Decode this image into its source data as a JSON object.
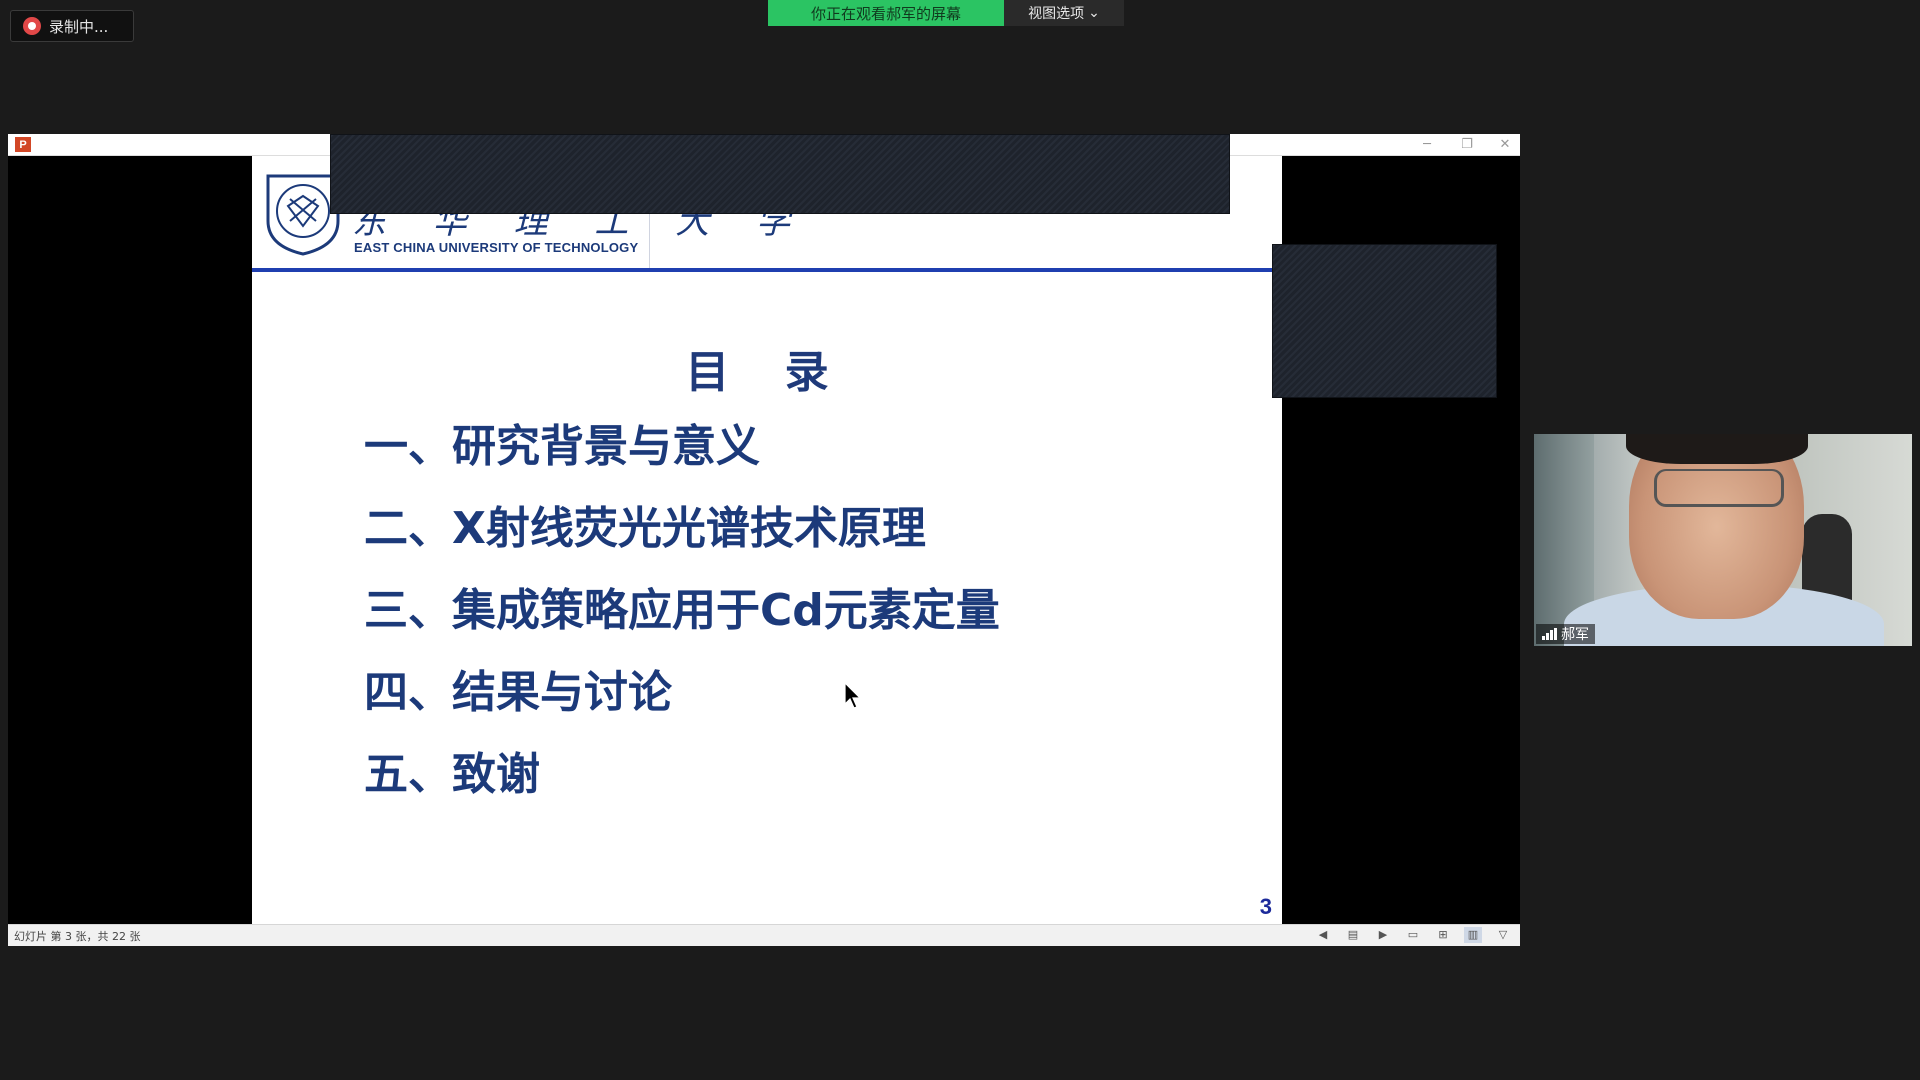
{
  "recording": {
    "label": "录制中..."
  },
  "share_bar": {
    "message": "你正在观看郝军的屏幕",
    "view_options": "视图选项",
    "chevron": "⌄"
  },
  "ppt_window": {
    "app_icon": "P",
    "status": "幻灯片 第 3 张，共 22 张"
  },
  "slide": {
    "university_cn": "东 华 理 工 大 学",
    "university_en": "EAST CHINA UNIVERSITY OF TECHNOLOGY",
    "title": "目 录",
    "items": [
      "一、研究背景与意义",
      "二、X射线荧光光谱技术原理",
      "三、集成策略应用于Cd元素定量",
      "四、结果与讨论",
      "五、致谢"
    ],
    "page_number": "3"
  },
  "participant": {
    "name": "郝军"
  },
  "colors": {
    "slide_text": "#1c3a7a",
    "accent_line": "#1f3fb0",
    "share_green": "#2bc463"
  }
}
